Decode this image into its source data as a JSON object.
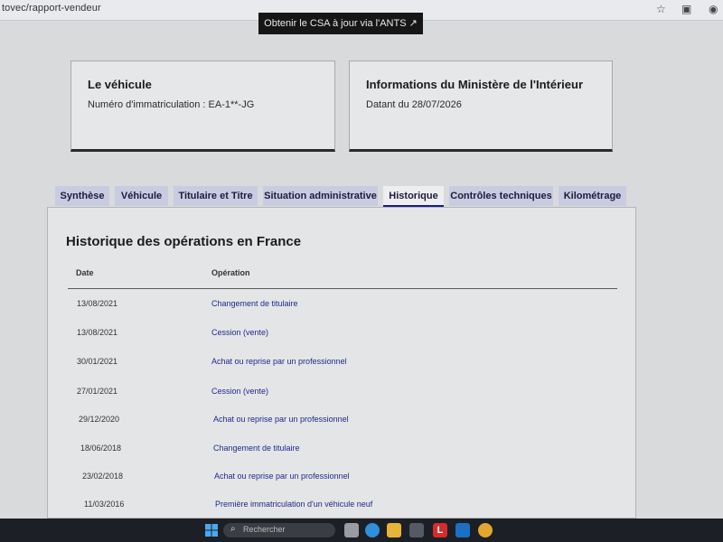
{
  "browser": {
    "url": "tovec/rapport-vendeur",
    "icons": [
      "star-icon",
      "extensions-icon",
      "profile-icon"
    ]
  },
  "banner": {
    "label": "Obtenir le CSA à jour via l'ANTS",
    "icon": "external-link-icon"
  },
  "vehicle_card": {
    "title": "Le véhicule",
    "text": "Numéro d'immatriculation : EA-1**-JG"
  },
  "ministry_card": {
    "title": "Informations du Ministère de l'Intérieur",
    "text": "Datant du 28/07/2026"
  },
  "tabs": [
    {
      "label": "Synthèse",
      "active": false
    },
    {
      "label": "Véhicule",
      "active": false
    },
    {
      "label": "Titulaire et Titre",
      "active": false
    },
    {
      "label": "Situation administrative",
      "active": false
    },
    {
      "label": "Historique",
      "active": true
    },
    {
      "label": "Contrôles techniques",
      "active": false
    },
    {
      "label": "Kilométrage",
      "active": false
    }
  ],
  "history": {
    "title": "Historique des opérations en France",
    "columns": [
      "Date",
      "Opération"
    ],
    "rows": [
      {
        "date": "13/08/2021",
        "operation": "Changement de titulaire"
      },
      {
        "date": "13/08/2021",
        "operation": "Cession (vente)"
      },
      {
        "date": "30/01/2021",
        "operation": "Achat ou reprise par un professionnel"
      },
      {
        "date": "27/01/2021",
        "operation": "Cession (vente)"
      },
      {
        "date": "29/12/2020",
        "operation": "Achat ou reprise par un professionnel"
      },
      {
        "date": "18/06/2018",
        "operation": "Changement de titulaire"
      },
      {
        "date": "23/02/2018",
        "operation": "Achat ou reprise par un professionnel"
      },
      {
        "date": "11/03/2016",
        "operation": "Première immatriculation d'un véhicule neuf"
      }
    ]
  },
  "taskbar": {
    "search_placeholder": "Rechercher",
    "apps": [
      "windows-start-icon",
      "task-view-icon",
      "file-explorer-icon",
      "edge-icon",
      "store-icon",
      "app-l-icon",
      "mail-icon",
      "chrome-icon"
    ]
  },
  "colors": {
    "tab_bg": "#c9cbe0",
    "link_blue": "#1f2a8a",
    "banner_bg": "#161616"
  }
}
